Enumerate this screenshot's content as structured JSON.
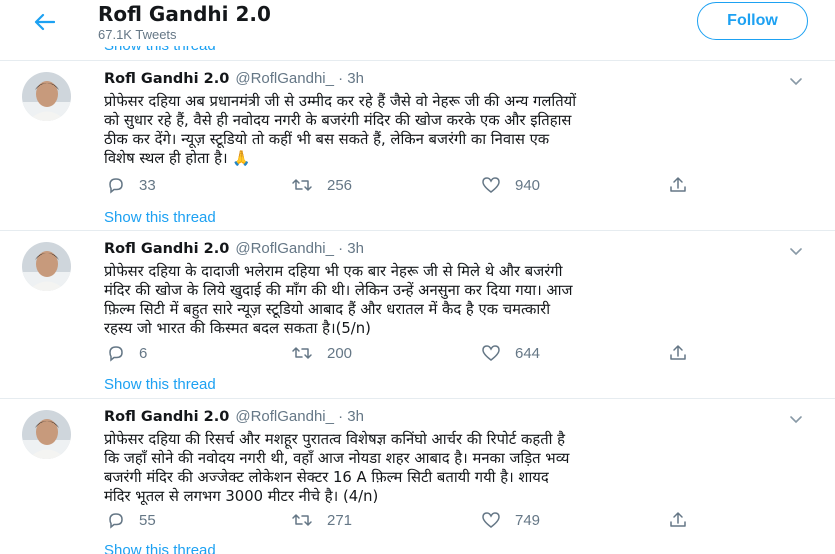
{
  "header": {
    "name": "Rofl Gandhi 2.0",
    "tweet_count": "67.1K Tweets",
    "follow_label": "Follow"
  },
  "show_thread_label": "Show this thread",
  "tweets": [
    {
      "name": "Rofl Gandhi 2.0",
      "handle": "@RoflGandhi_ · 3h",
      "lines": [
        "प्रोफेसर दहिया अब प्रधानमंत्री जी से उम्मीद कर रहे हैं जैसे वो नेहरू जी की अन्य गलतियों",
        "को सुधार रहे हैं, वैसे ही नवोदय नगरी के बजरंगी मंदिर की खोज करके एक और इतिहास",
        "ठीक कर देंगे। न्यूज़ स्टूडियो तो कहीं भी बस सकते हैं, लेकिन बजरंगी का निवास एक",
        "विशेष स्थल ही होता है। 🙏"
      ],
      "replies": "33",
      "retweets": "256",
      "likes": "940"
    },
    {
      "name": "Rofl Gandhi 2.0",
      "handle": "@RoflGandhi_ · 3h",
      "lines": [
        "प्रोफेसर दहिया के दादाजी भलेराम दहिया भी एक बार नेहरू जी से मिले थे और बजरंगी",
        "मंदिर की खोज के लिये खुदाई की माँग की थी। लेकिन उन्हें अनसुना कर दिया गया। आज",
        "फ़िल्म सिटी में बहुत सारे न्यूज़ स्टूडियो आबाद हैं और धरातल में कैद है एक चमत्कारी",
        "रहस्य जो भारत की किस्मत बदल सकता है।(5/n)"
      ],
      "replies": "6",
      "retweets": "200",
      "likes": "644"
    },
    {
      "name": "Rofl Gandhi 2.0",
      "handle": "@RoflGandhi_ · 3h",
      "lines": [
        "प्रोफेसर दहिया की रिसर्च और मशहूर पुरातत्व विशेषज्ञ कनिंघो आर्चर की रिपोर्ट कहती है",
        "कि जहाँ सोने की नवोदय नगरी थी, वहाँ आज नोयडा शहर आबाद है। मनका जड़ित भव्य",
        "बजरंगी मंदिर की अज्जेक्ट लोकेशन सेक्टर 16 A फ़िल्म सिटी बतायी गयी है। शायद",
        "मंदिर भूतल से लगभग 3000 मीटर नीचे है। (4/n)"
      ],
      "replies": "55",
      "retweets": "271",
      "likes": "749"
    }
  ],
  "icons": [
    "back-arrow-icon",
    "chevron-down-icon",
    "reply-icon",
    "retweet-icon",
    "like-icon",
    "share-icon"
  ],
  "colors": {
    "accent": "#1da1f2",
    "muted": "#657786",
    "divider": "#e6ecf0"
  }
}
